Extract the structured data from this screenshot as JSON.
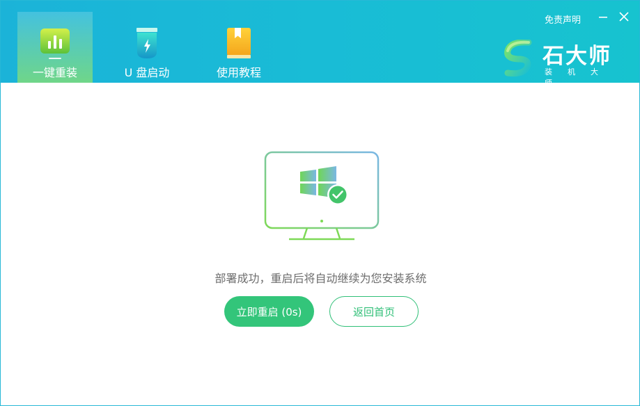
{
  "header": {
    "nav": [
      {
        "label": "一键重装",
        "icon": "bar-chart-icon",
        "active": true
      },
      {
        "label": "U 盘启动",
        "icon": "usb-flash-icon",
        "active": false
      },
      {
        "label": "使用教程",
        "icon": "book-icon",
        "active": false
      }
    ],
    "disclaimer": "免责声明",
    "minimize_icon": "minimize-icon",
    "close_icon": "close-icon",
    "logo": {
      "brand": "石大师",
      "subtitle": "装机大师"
    }
  },
  "main": {
    "status_icon": "monitor-windows-check-icon",
    "message": "部署成功，重启后将自动继续为您安装系统",
    "restart_button": "立即重启 (0s)",
    "home_button": "返回首页"
  },
  "colors": {
    "header_start": "#1bb3d8",
    "header_end": "#17c3cf",
    "accent_green": "#33c57a",
    "text_gray": "#6d6d6d"
  }
}
